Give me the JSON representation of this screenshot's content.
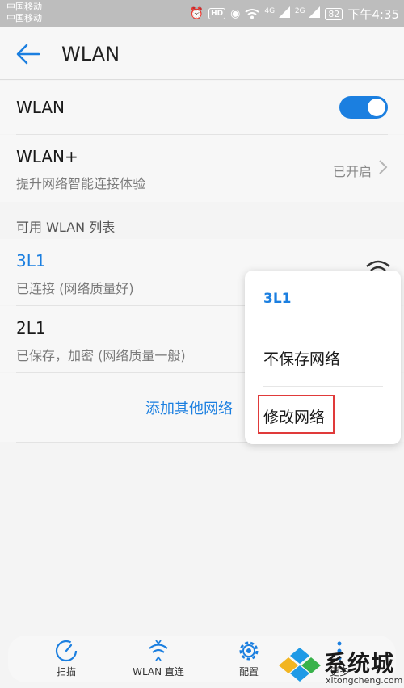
{
  "status_bar": {
    "carrier_1": "中国移动",
    "carrier_2": "中国移动",
    "net_4g": "4G",
    "net_2g": "2G",
    "battery": "82",
    "time": "下午4:35"
  },
  "header": {
    "title": "WLAN"
  },
  "wlan_toggle": {
    "label": "WLAN",
    "on": true
  },
  "wlan_plus": {
    "title": "WLAN+",
    "subtitle": "提升网络智能连接体验",
    "status": "已开启"
  },
  "network_list": {
    "header": "可用 WLAN 列表",
    "items": [
      {
        "name": "3L1",
        "status": "已连接 (网络质量好)"
      },
      {
        "name": "2L1",
        "status": "已保存，加密 (网络质量一般)"
      }
    ],
    "add_network": "添加其他网络"
  },
  "popup_menu": {
    "title": "3L1",
    "items": [
      "不保存网络",
      "修改网络"
    ]
  },
  "bottom_bar": {
    "items": [
      "扫描",
      "WLAN 直连",
      "配置",
      "更多"
    ]
  },
  "watermark": {
    "brand": "系统城",
    "url": "xitongcheng.com"
  },
  "colors": {
    "accent": "#1b7fe0",
    "highlight": "#e03a3a"
  }
}
